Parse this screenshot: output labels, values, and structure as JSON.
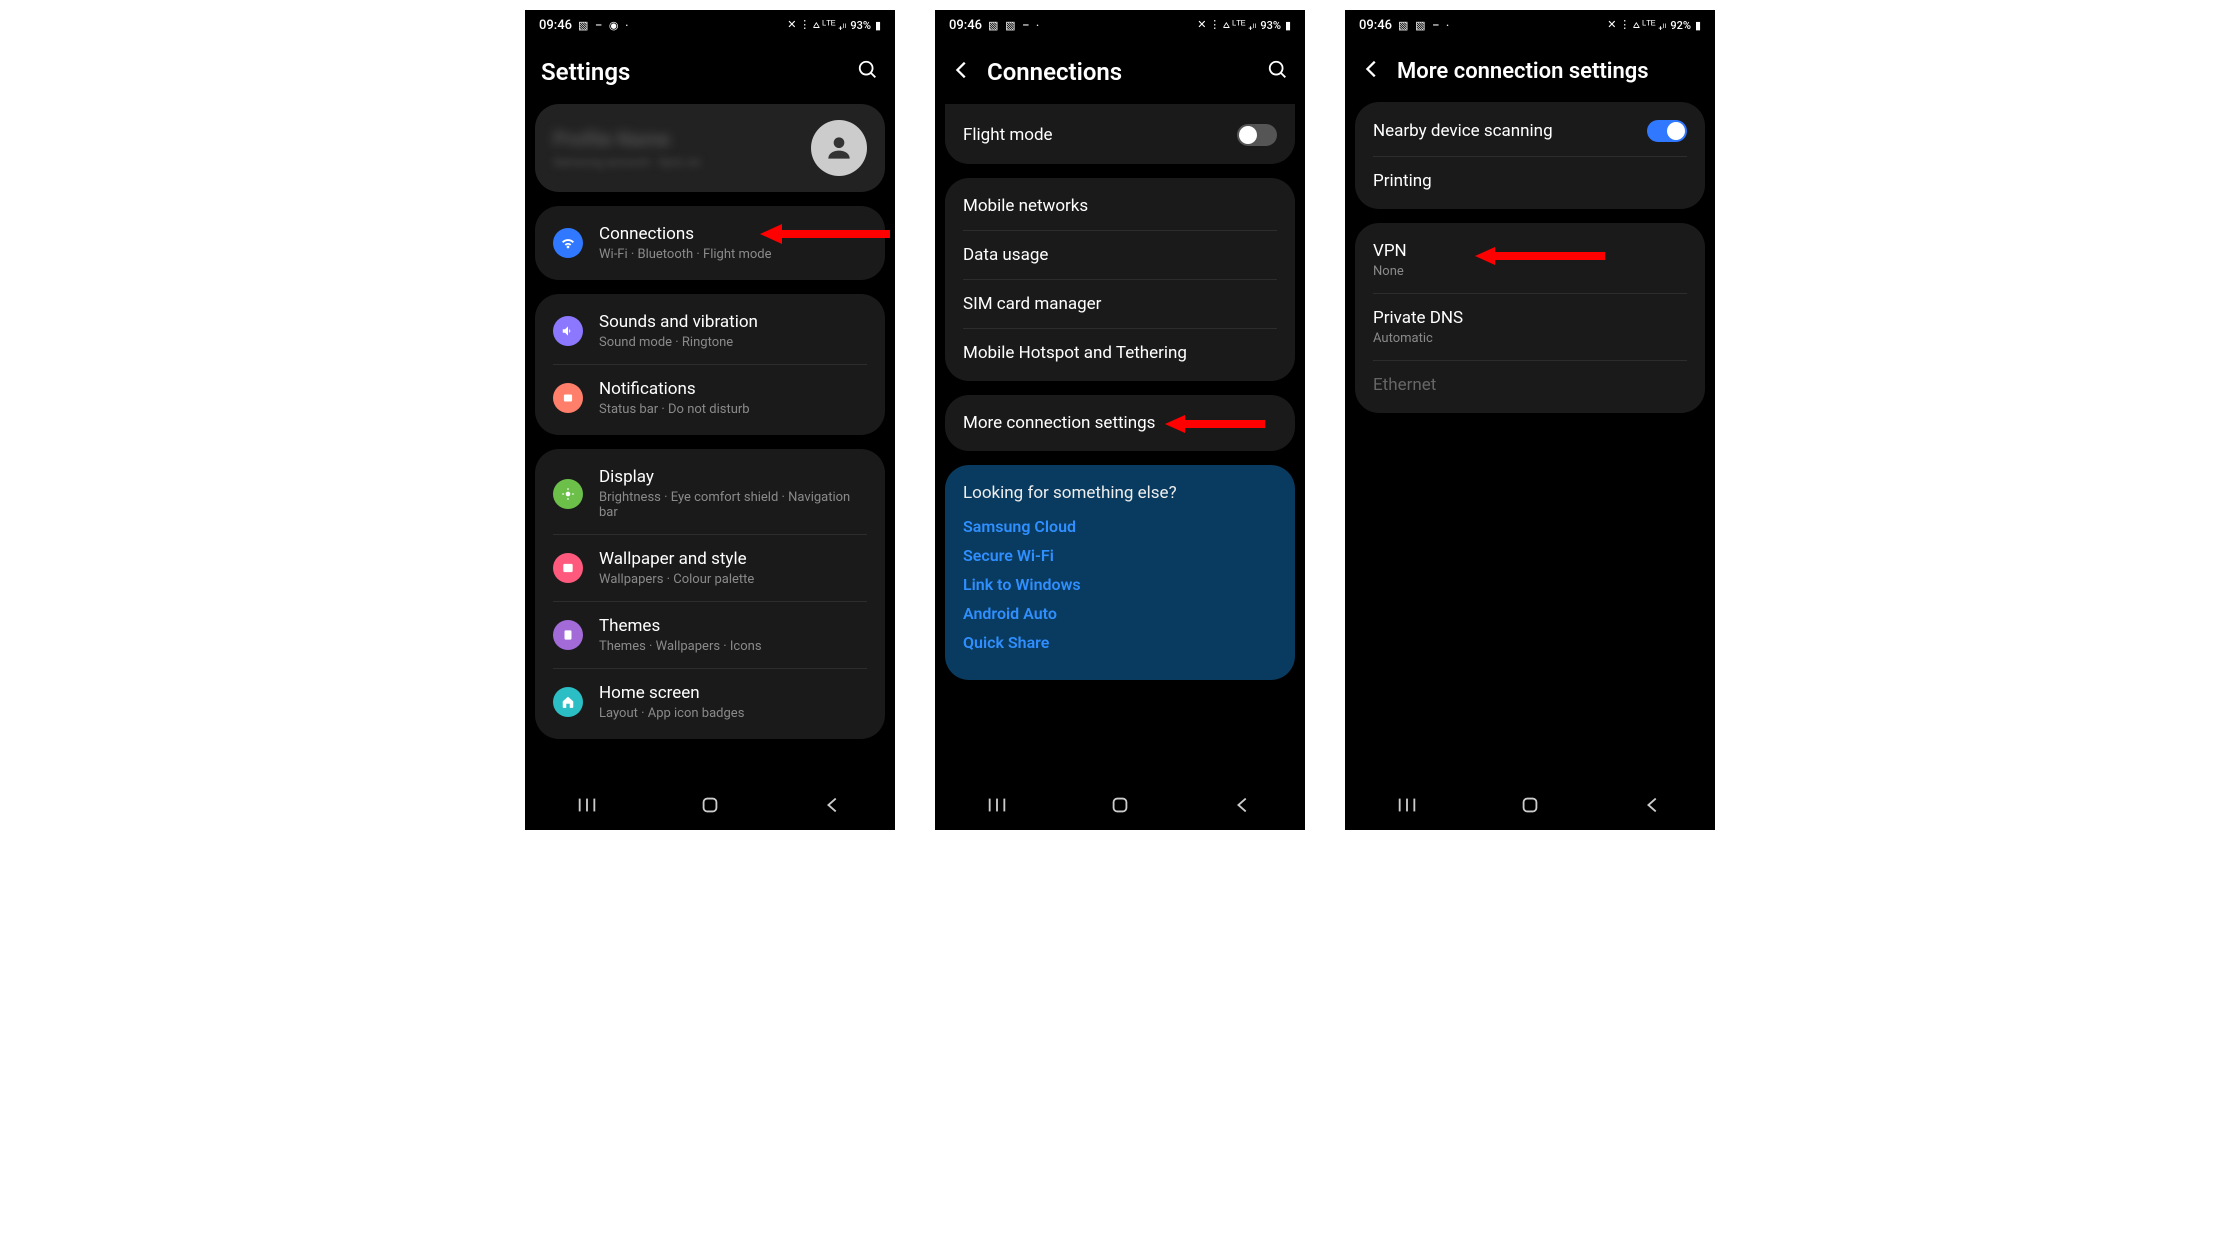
{
  "screen1": {
    "status": {
      "time": "09:46",
      "battery": "93%"
    },
    "title": "Settings",
    "profile": {
      "name": "Profile Name",
      "sub": "Samsung account · Sync on"
    },
    "groups": [
      {
        "items": [
          {
            "icon": "wifi",
            "color": "ic-blue",
            "title": "Connections",
            "sub": "Wi-Fi · Bluetooth · Flight mode",
            "arrow": true
          }
        ]
      },
      {
        "items": [
          {
            "icon": "sound",
            "color": "ic-purple",
            "title": "Sounds and vibration",
            "sub": "Sound mode · Ringtone"
          },
          {
            "icon": "bell",
            "color": "ic-orange",
            "title": "Notifications",
            "sub": "Status bar · Do not disturb"
          }
        ]
      },
      {
        "items": [
          {
            "icon": "sun",
            "color": "ic-green",
            "title": "Display",
            "sub": "Brightness · Eye comfort shield · Navigation bar"
          },
          {
            "icon": "image",
            "color": "ic-pink",
            "title": "Wallpaper and style",
            "sub": "Wallpapers · Colour palette"
          },
          {
            "icon": "theme",
            "color": "ic-violet",
            "title": "Themes",
            "sub": "Themes · Wallpapers · Icons"
          },
          {
            "icon": "home",
            "color": "ic-teal",
            "title": "Home screen",
            "sub": "Layout · App icon badges"
          }
        ]
      }
    ]
  },
  "screen2": {
    "status": {
      "time": "09:46",
      "battery": "93%"
    },
    "title": "Connections",
    "flight_mode": "Flight mode",
    "group1": [
      "Mobile networks",
      "Data usage",
      "SIM card manager",
      "Mobile Hotspot and Tethering"
    ],
    "more": "More connection settings",
    "suggest_head": "Looking for something else?",
    "suggestions": [
      "Samsung Cloud",
      "Secure Wi-Fi",
      "Link to Windows",
      "Android Auto",
      "Quick Share"
    ]
  },
  "screen3": {
    "status": {
      "time": "09:46",
      "battery": "92%"
    },
    "title": "More connection settings",
    "group1": [
      {
        "title": "Nearby device scanning",
        "toggle": "on"
      },
      {
        "title": "Printing"
      }
    ],
    "group2": [
      {
        "title": "VPN",
        "sub": "None",
        "arrow": true
      },
      {
        "title": "Private DNS",
        "sub": "Automatic"
      },
      {
        "title": "Ethernet",
        "disabled": true
      }
    ]
  }
}
